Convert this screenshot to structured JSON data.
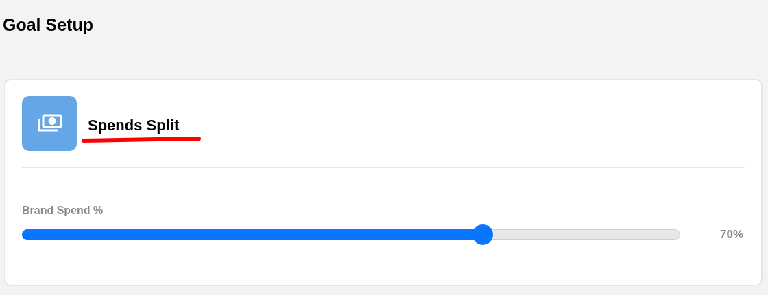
{
  "page": {
    "title": "Goal Setup"
  },
  "card": {
    "title": "Spends Split",
    "slider": {
      "label": "Brand Spend %",
      "level": 0.7,
      "reading": "70%"
    }
  }
}
